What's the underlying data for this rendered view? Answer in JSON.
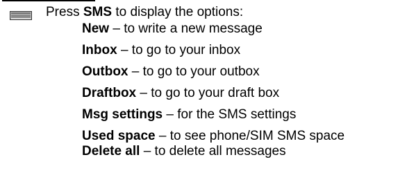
{
  "intro": {
    "prefix": "Press ",
    "key": "SMS",
    "suffix": " to display the options:"
  },
  "options": [
    {
      "term": "New",
      "desc": " – to write a new message"
    },
    {
      "term": "Inbox",
      "desc": " – to go to your inbox"
    },
    {
      "term": "Outbox",
      "desc": " – to go to your outbox"
    },
    {
      "term": "Draftbox",
      "desc": " – to go to your draft box"
    },
    {
      "term": "Msg settings",
      "desc": " – for the SMS settings"
    },
    {
      "term": "Used space",
      "desc": " – to see phone/SIM SMS space"
    },
    {
      "term": "Delete all",
      "desc": " – to delete all messages"
    }
  ],
  "icon": "softkey-icon"
}
